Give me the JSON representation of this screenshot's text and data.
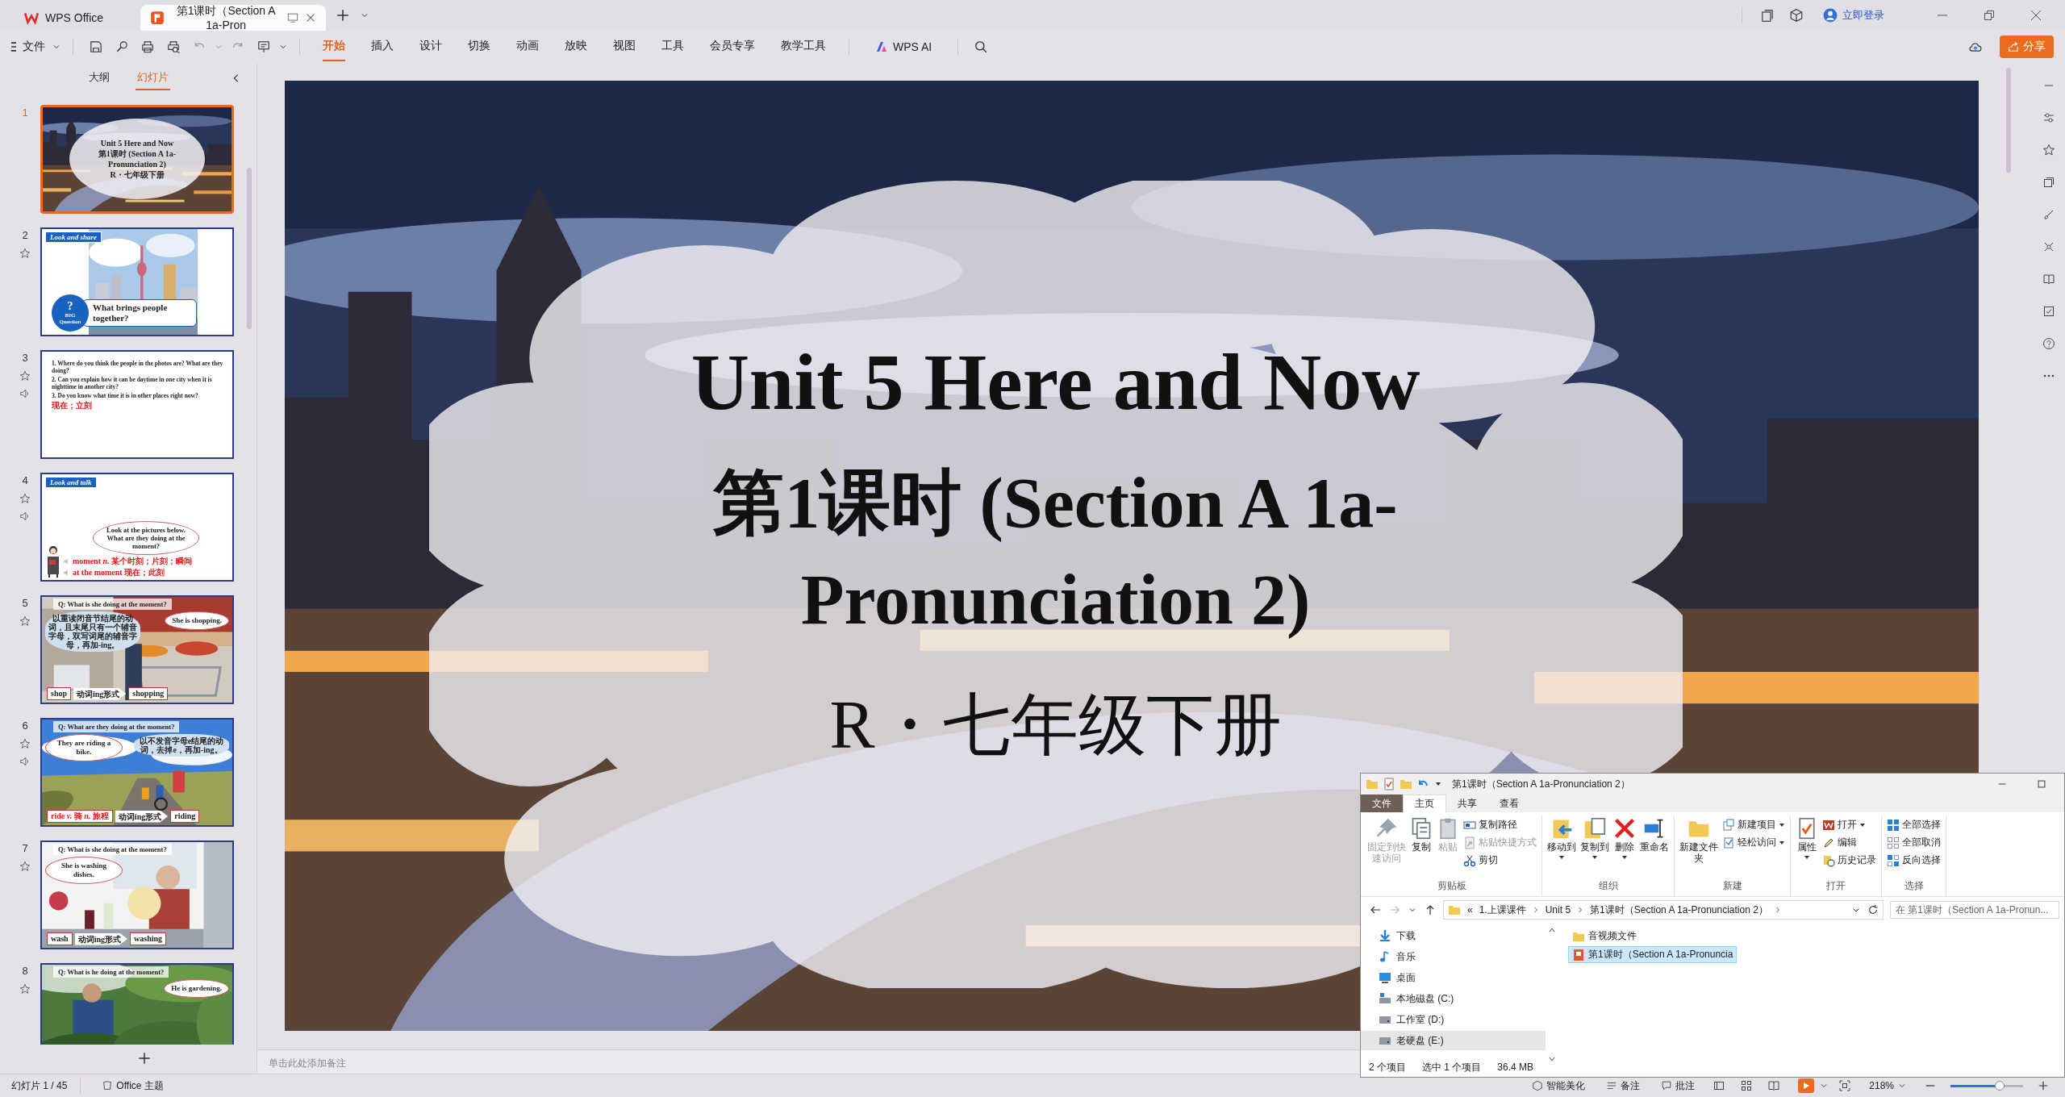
{
  "app_tabs": [
    {
      "kind": "home",
      "label": "WPS Office",
      "selected": false
    },
    {
      "kind": "document",
      "label": "第1课时（Section A 1a-Pron",
      "selected": true
    }
  ],
  "account": {
    "label": "立即登录"
  },
  "file_menu": "文件",
  "ribbon_tabs": [
    {
      "label": "开始",
      "selected": true
    },
    {
      "label": "插入",
      "selected": false
    },
    {
      "label": "设计",
      "selected": false
    },
    {
      "label": "切换",
      "selected": false
    },
    {
      "label": "动画",
      "selected": false
    },
    {
      "label": "放映",
      "selected": false
    },
    {
      "label": "视图",
      "selected": false
    },
    {
      "label": "工具",
      "selected": false
    },
    {
      "label": "会员专享",
      "selected": false
    },
    {
      "label": "教学工具",
      "selected": false
    }
  ],
  "ai_button": "WPS AI",
  "share_button": "分享",
  "panel": {
    "tabs": [
      {
        "label": "大纲",
        "selected": false
      },
      {
        "label": "幻灯片",
        "selected": true
      }
    ],
    "slides": [
      {
        "number": "1",
        "selected": true,
        "animated": false,
        "audio": false,
        "kind": "cover",
        "lines": [
          "Unit 5 Here and Now",
          "第1课时 (Section A 1a-Pronunciation 2)",
          "R・七年级下册"
        ]
      },
      {
        "number": "2",
        "selected": false,
        "animated": true,
        "audio": false,
        "kind": "big_question",
        "tag": "Look and share",
        "badge": [
          "?",
          "BIG",
          "Question"
        ],
        "lines": [
          "What brings people together?"
        ]
      },
      {
        "number": "3",
        "selected": false,
        "animated": true,
        "audio": true,
        "kind": "questions",
        "lines": [
          {
            "text": "1. Where do you think the people in the photos are? What are they doing?",
            "red": false
          },
          {
            "text": "2. Can you explain how it can be daytime in one city when it is nighttime in another city?",
            "red": false
          },
          {
            "text": "3. Do you know what time it is in other places **right now**?",
            "red": false
          },
          {
            "text": "现在；立刻",
            "red": true
          }
        ]
      },
      {
        "number": "4",
        "selected": false,
        "animated": true,
        "audio": true,
        "kind": "talk",
        "tag": "Look and talk",
        "bubble": "Look at the pictures below. What are they doing **at the moment**?",
        "notes": [
          "moment *n.* 某个时刻；片刻；瞬间",
          "at the moment 现在；此刻"
        ]
      },
      {
        "number": "5",
        "selected": false,
        "animated": true,
        "audio": false,
        "kind": "photo_question",
        "heading": "Q: What is she doing at the moment?",
        "bubbles": [
          {
            "kind": "rule",
            "text": "以重读闭音节结尾的动词，且末尾只有一个辅音字母，双写词尾的辅音字母，再加-ing。"
          },
          {
            "kind": "answer",
            "text": "She is **shopping**."
          }
        ],
        "chain": {
          "from": {
            "text": "shop",
            "red": false
          },
          "arrow": "动词ing形式",
          "to": "shop**ping**"
        }
      },
      {
        "number": "6",
        "selected": false,
        "animated": true,
        "audio": true,
        "kind": "photo_question",
        "heading": "Q: What are they doing at the moment?",
        "bubbles": [
          {
            "kind": "answer",
            "text": "They are **riding a bike**."
          },
          {
            "kind": "rule",
            "text": "以不发音字母e结尾的动词，去掉e，再加-ing。"
          }
        ],
        "chain": {
          "from": {
            "text": "ride *v.* 骑 *n.* 旅程",
            "red": true
          },
          "arrow": "动词ing形式",
          "to": "rid**ing**"
        }
      },
      {
        "number": "7",
        "selected": false,
        "animated": true,
        "audio": false,
        "kind": "photo_question",
        "heading": "Q: What is she doing at the moment?",
        "bubbles": [
          {
            "kind": "answer",
            "text": "She is **washing dishes**."
          }
        ],
        "chain": {
          "from": {
            "text": "wash",
            "red": false
          },
          "arrow": "动词ing形式",
          "to": "wash**ing**"
        }
      },
      {
        "number": "8",
        "selected": false,
        "animated": true,
        "audio": false,
        "kind": "photo_question",
        "heading": "Q: What is he doing at the moment?",
        "bubbles": [
          {
            "kind": "answer",
            "text": "He is **gardening**."
          }
        ]
      }
    ]
  },
  "slide": {
    "title": "Unit 5 Here and Now",
    "subtitle": "第1课时 (Section A 1a-Pronunciation 2)",
    "grade": "R・七年级下册"
  },
  "notes_placeholder": "单击此处添加备注",
  "explorer": {
    "title": "第1课时（Section A 1a-Pronunciation 2）",
    "tabs": [
      {
        "kind": "file",
        "label": "文件",
        "selected": false
      },
      {
        "kind": "tab",
        "label": "主页",
        "selected": true
      },
      {
        "kind": "tab",
        "label": "共享",
        "selected": false
      },
      {
        "kind": "tab",
        "label": "查看",
        "selected": false
      }
    ],
    "groups": [
      {
        "label": "剪贴板",
        "commands": [
          {
            "kind": "pin",
            "label": "固定到快速访问",
            "disabled": true,
            "menu": false
          },
          {
            "kind": "copy",
            "label": "复制",
            "disabled": false,
            "menu": false
          },
          {
            "kind": "paste",
            "label": "粘贴",
            "disabled": true,
            "menu": false
          },
          {
            "kind": "path",
            "label": "复制路径",
            "disabled": false,
            "menu": false
          },
          {
            "kind": "shortcut",
            "label": "粘贴快捷方式",
            "disabled": true,
            "menu": false
          },
          {
            "kind": "cut",
            "label": "剪切",
            "disabled": false,
            "menu": false
          }
        ]
      },
      {
        "label": "组织",
        "commands": [
          {
            "kind": "move",
            "label": "移动到",
            "disabled": false,
            "menu": true
          },
          {
            "kind": "copyto",
            "label": "复制到",
            "disabled": false,
            "menu": true
          },
          {
            "kind": "delete",
            "label": "删除",
            "disabled": false,
            "menu": true
          },
          {
            "kind": "rename",
            "label": "重命名",
            "disabled": false,
            "menu": false
          }
        ]
      },
      {
        "label": "新建",
        "commands": [
          {
            "kind": "folder",
            "label": "新建文件夹",
            "disabled": false,
            "menu": false
          },
          {
            "kind": "newitem",
            "label": "新建项目",
            "disabled": false,
            "menu": true
          },
          {
            "kind": "easy",
            "label": "轻松访问",
            "disabled": false,
            "menu": true
          }
        ]
      },
      {
        "label": "打开",
        "commands": [
          {
            "kind": "properties",
            "label": "属性",
            "disabled": false,
            "menu": true
          },
          {
            "kind": "open",
            "label": "打开",
            "disabled": false,
            "menu": true
          },
          {
            "kind": "edit",
            "label": "编辑",
            "disabled": false,
            "menu": false
          },
          {
            "kind": "history",
            "label": "历史记录",
            "disabled": false,
            "menu": false
          }
        ]
      },
      {
        "label": "选择",
        "commands": [
          {
            "kind": "selectall",
            "label": "全部选择",
            "disabled": false,
            "menu": false
          },
          {
            "kind": "selectnone",
            "label": "全部取消",
            "disabled": false,
            "menu": false
          },
          {
            "kind": "invert",
            "label": "反向选择",
            "disabled": false,
            "menu": false
          }
        ]
      }
    ],
    "address_overflow": "«",
    "address": [
      "1.上课课件",
      "Unit 5",
      "第1课时（Section A 1a-Pronunciation 2）"
    ],
    "search": {
      "placeholder": "在 第1课时（Section A 1a-Pronun..."
    },
    "tree": [
      {
        "kind": "download",
        "label": "下载",
        "selected": false
      },
      {
        "kind": "music",
        "label": "音乐",
        "selected": false
      },
      {
        "kind": "desktop",
        "label": "桌面",
        "selected": false
      },
      {
        "kind": "system_drive",
        "label": "本地磁盘 (C:)",
        "selected": false
      },
      {
        "kind": "drive",
        "label": "工作室 (D:)",
        "selected": false
      },
      {
        "kind": "drive",
        "label": "老硬盘 (E:)",
        "selected": true
      }
    ],
    "files": [
      {
        "kind": "folder",
        "label": "音视频文件",
        "selected": false
      },
      {
        "kind": "presentation",
        "label": "第1课时（Section A 1a-Pronuncia",
        "selected": true
      }
    ],
    "status": [
      "2 个项目",
      "选中 1 个项目",
      "36.4 MB"
    ]
  },
  "status_bar": {
    "slide_count": "幻灯片 1 / 45",
    "theme": "Office 主题",
    "beautify": "智能美化",
    "notes": "备注",
    "comments": "批注",
    "zoom": "218%",
    "zoom_slider": {
      "level": 0.68
    }
  }
}
